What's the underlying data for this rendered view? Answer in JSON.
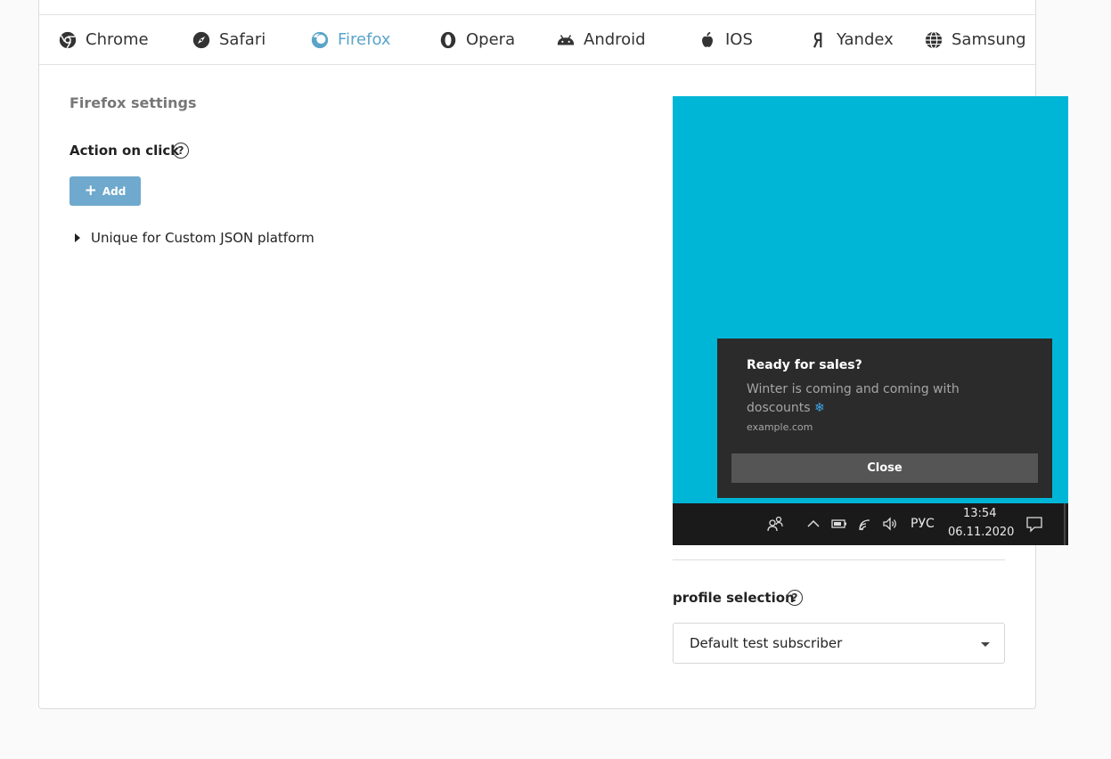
{
  "tabs": [
    {
      "label": "Chrome",
      "icon": "chrome-icon"
    },
    {
      "label": "Safari",
      "icon": "safari-icon"
    },
    {
      "label": "Firefox",
      "icon": "firefox-icon",
      "active": true
    },
    {
      "label": "Opera",
      "icon": "opera-icon"
    },
    {
      "label": "Android",
      "icon": "android-icon"
    },
    {
      "label": "IOS",
      "icon": "apple-icon"
    },
    {
      "label": "Yandex",
      "icon": "yandex-icon"
    },
    {
      "label": "Samsung",
      "icon": "globe-icon"
    }
  ],
  "settings": {
    "title": "Firefox settings",
    "action_label": "Action on click",
    "help_glyph": "?",
    "add_label": "Add",
    "add_glyph": "+",
    "expander_label": "Unique for Custom JSON platform"
  },
  "preview": {
    "notification": {
      "title": "Ready for sales?",
      "body": "Winter is coming and coming with doscounts",
      "emoji": "❄",
      "site": "example.com",
      "close_label": "Close"
    },
    "taskbar": {
      "lang": "РУС",
      "time": "13:54",
      "date": "06.11.2020"
    }
  },
  "profile": {
    "label": "profile selection",
    "selected": "Default test subscriber"
  },
  "colors": {
    "accent": "#5ba4c9",
    "add_button": "#6fa9cd",
    "preview_background": "#00b6d6",
    "notification_background": "#2b2b2b"
  }
}
